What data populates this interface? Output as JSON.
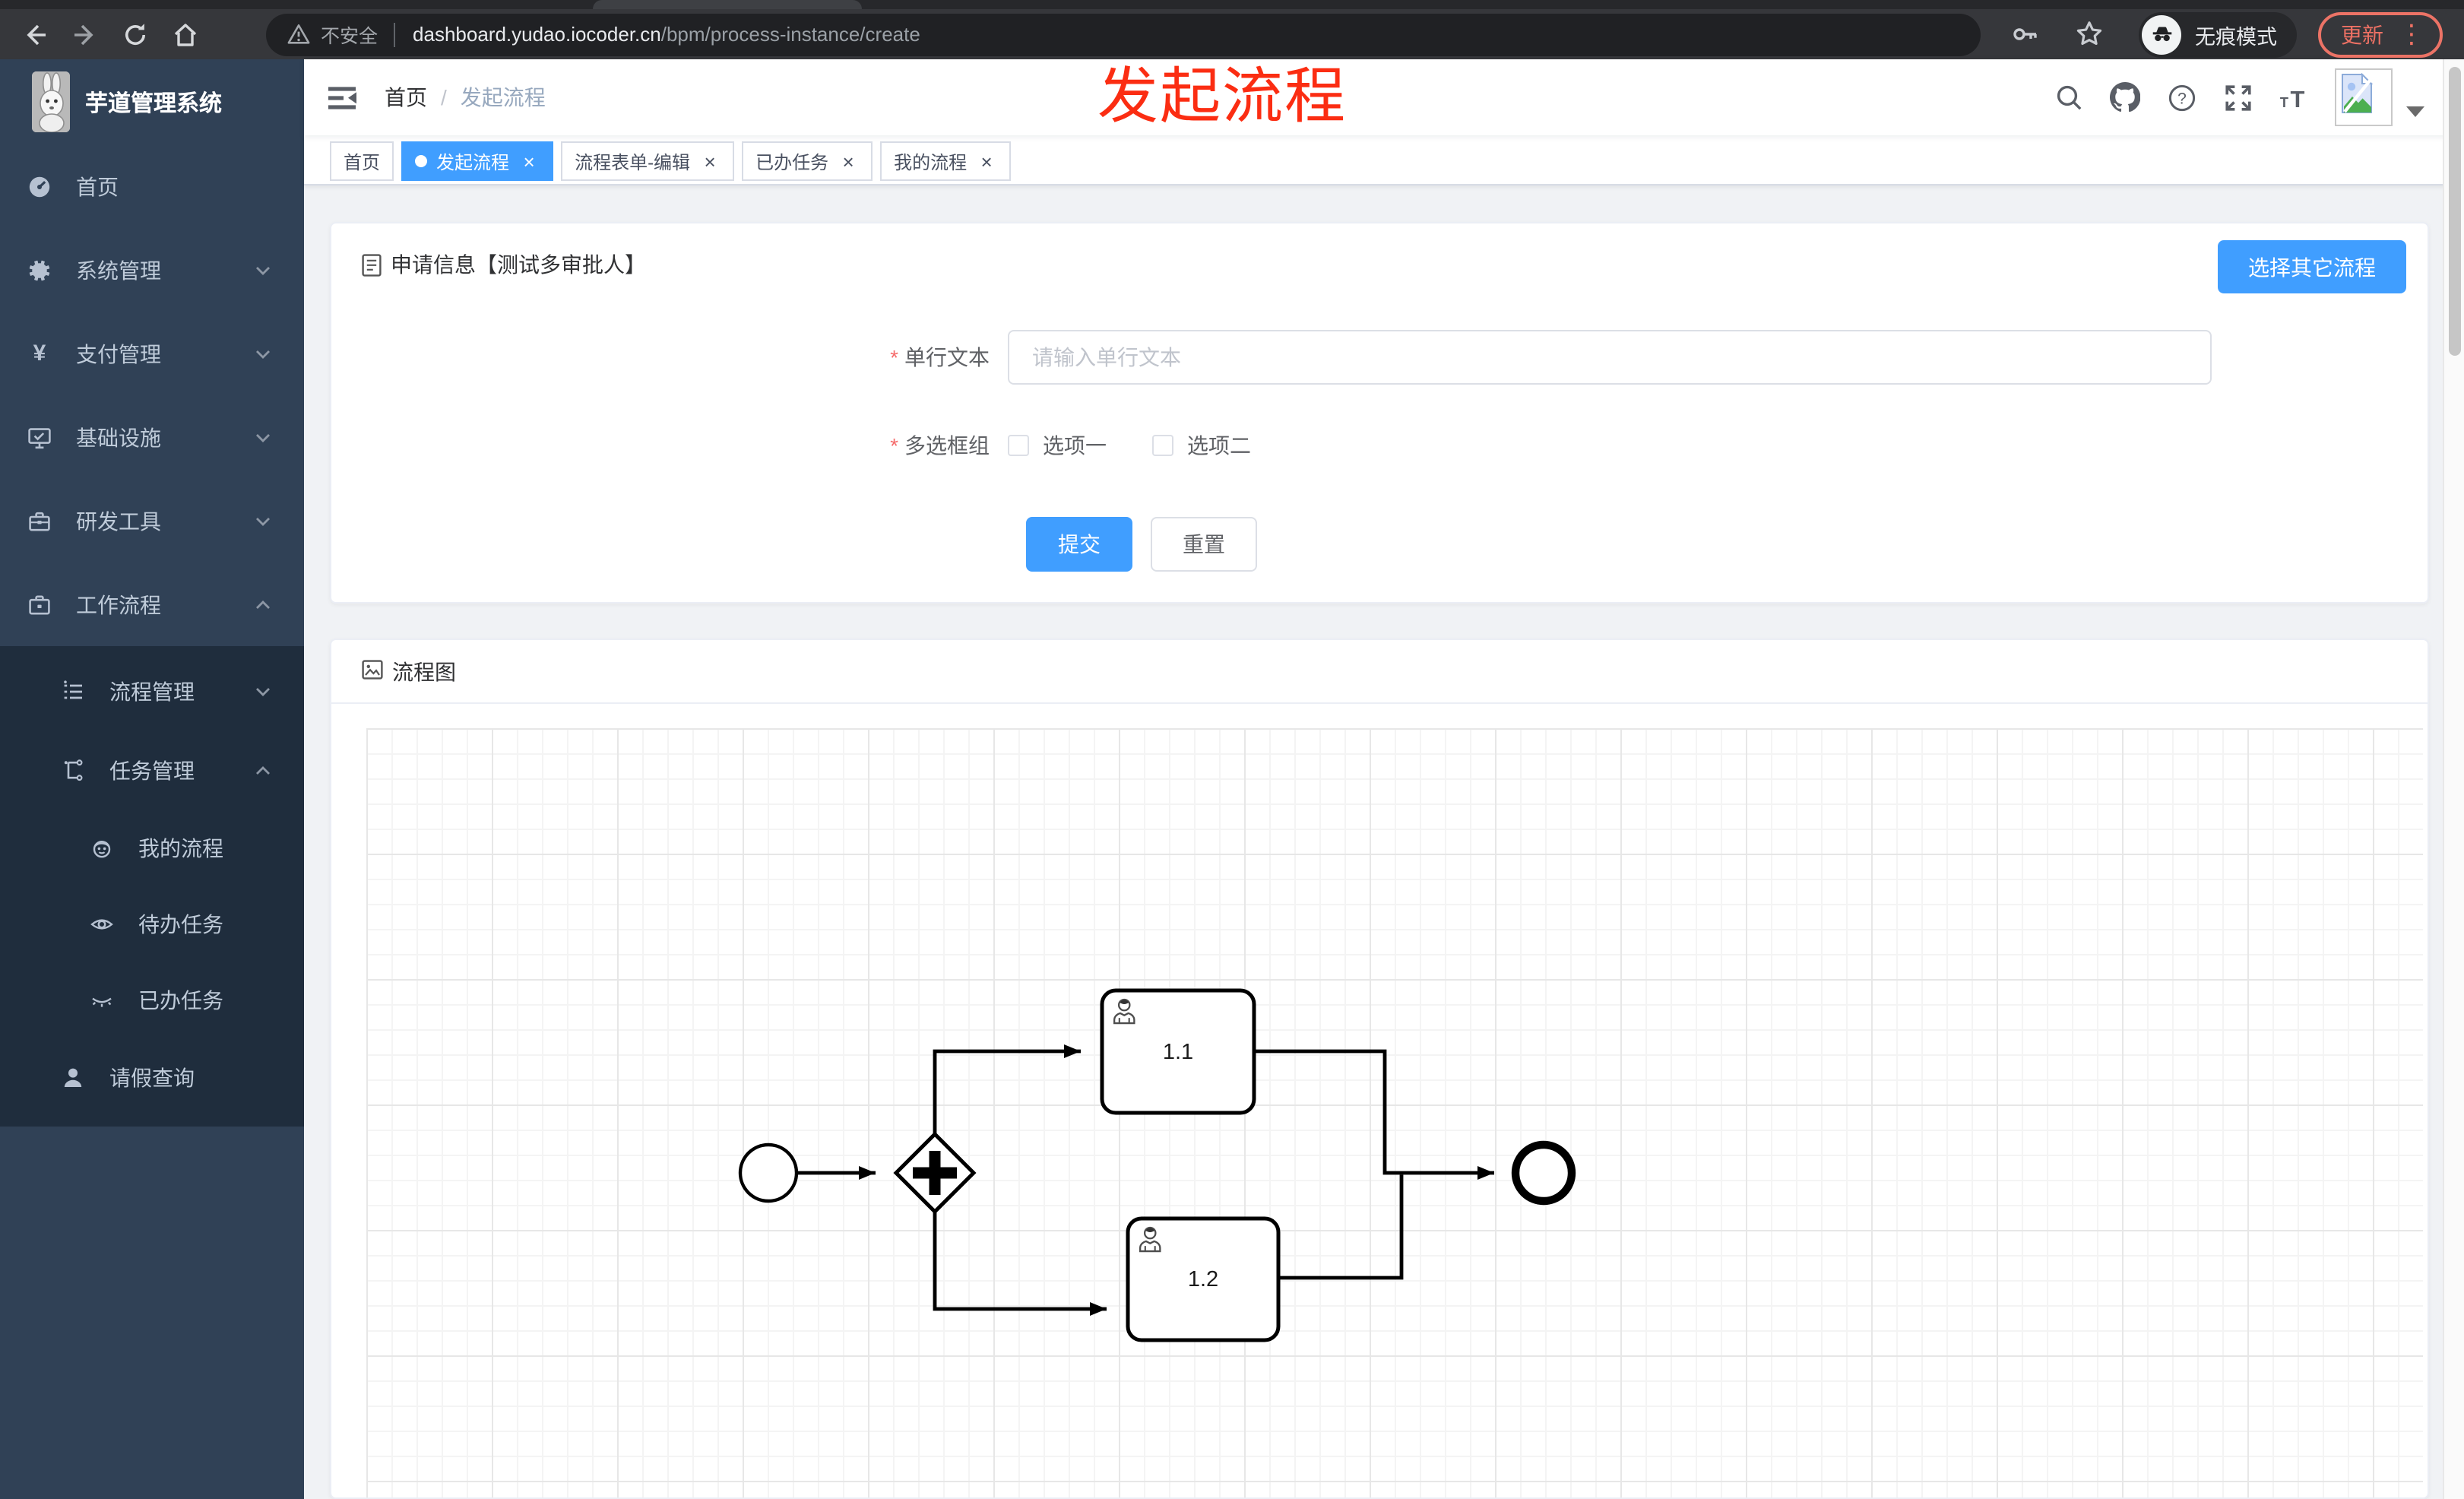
{
  "browser": {
    "security_label": "不安全",
    "url_host": "dashboard.yudao.iocoder.cn",
    "url_path": "/bpm/process-instance/create",
    "incognito_label": "无痕模式",
    "update_label": "更新",
    "menu_dots": "⋮"
  },
  "annotation": {
    "text": "发起流程"
  },
  "sidebar": {
    "brand": "芋道管理系统",
    "items": [
      {
        "label": "首页",
        "icon": "dashboard-icon",
        "expandable": false
      },
      {
        "label": "系统管理",
        "icon": "gear-icon",
        "expandable": true
      },
      {
        "label": "支付管理",
        "icon": "yen-icon",
        "expandable": true
      },
      {
        "label": "基础设施",
        "icon": "monitor-icon",
        "expandable": true
      },
      {
        "label": "研发工具",
        "icon": "toolbox-icon",
        "expandable": true
      },
      {
        "label": "工作流程",
        "icon": "briefcase-icon",
        "expandable": true,
        "expanded": true
      }
    ],
    "sub_items": [
      {
        "label": "流程管理",
        "icon": "list-tree-icon",
        "expanded": false
      },
      {
        "label": "任务管理",
        "icon": "flow-tree-icon",
        "expanded": true
      }
    ],
    "task_items": [
      {
        "label": "我的流程",
        "icon": "face-icon"
      },
      {
        "label": "待办任务",
        "icon": "eye-open-icon"
      },
      {
        "label": "已办任务",
        "icon": "eye-closed-icon"
      }
    ],
    "leave_item": {
      "label": "请假查询",
      "icon": "user-icon"
    }
  },
  "navbar": {
    "breadcrumb_home": "首页",
    "separator": "/",
    "breadcrumb_current": "发起流程"
  },
  "tabs_meta": {
    "close_glyph": "×"
  },
  "tabs": [
    {
      "label": "首页",
      "active": false,
      "closable": false
    },
    {
      "label": "发起流程",
      "active": true,
      "closable": true
    },
    {
      "label": "流程表单-编辑",
      "active": false,
      "closable": true
    },
    {
      "label": "已办任务",
      "active": false,
      "closable": true
    },
    {
      "label": "我的流程",
      "active": false,
      "closable": true
    }
  ],
  "form_card": {
    "title": "申请信息【测试多审批人】",
    "select_other_button": "选择其它流程",
    "required_mark": "*",
    "fields": {
      "text": {
        "label": "单行文本",
        "placeholder": "请输入单行文本",
        "value": ""
      },
      "checkbox_group": {
        "label": "多选框组",
        "options": [
          {
            "label": "选项一",
            "checked": false
          },
          {
            "label": "选项二",
            "checked": false
          }
        ]
      }
    },
    "submit_label": "提交",
    "reset_label": "重置"
  },
  "diagram_card": {
    "title": "流程图",
    "nodes": {
      "type": "bpmn",
      "start": "start-event",
      "gateway": "parallel-gateway",
      "task1": "1.1",
      "task2": "1.2",
      "end": "end-event"
    }
  },
  "colors": {
    "primary": "#409eff",
    "annotation_red": "#fb2d12",
    "sidebar_bg": "#304156",
    "submenu_bg": "#1f2d3d",
    "chrome_bg": "#36373b"
  }
}
